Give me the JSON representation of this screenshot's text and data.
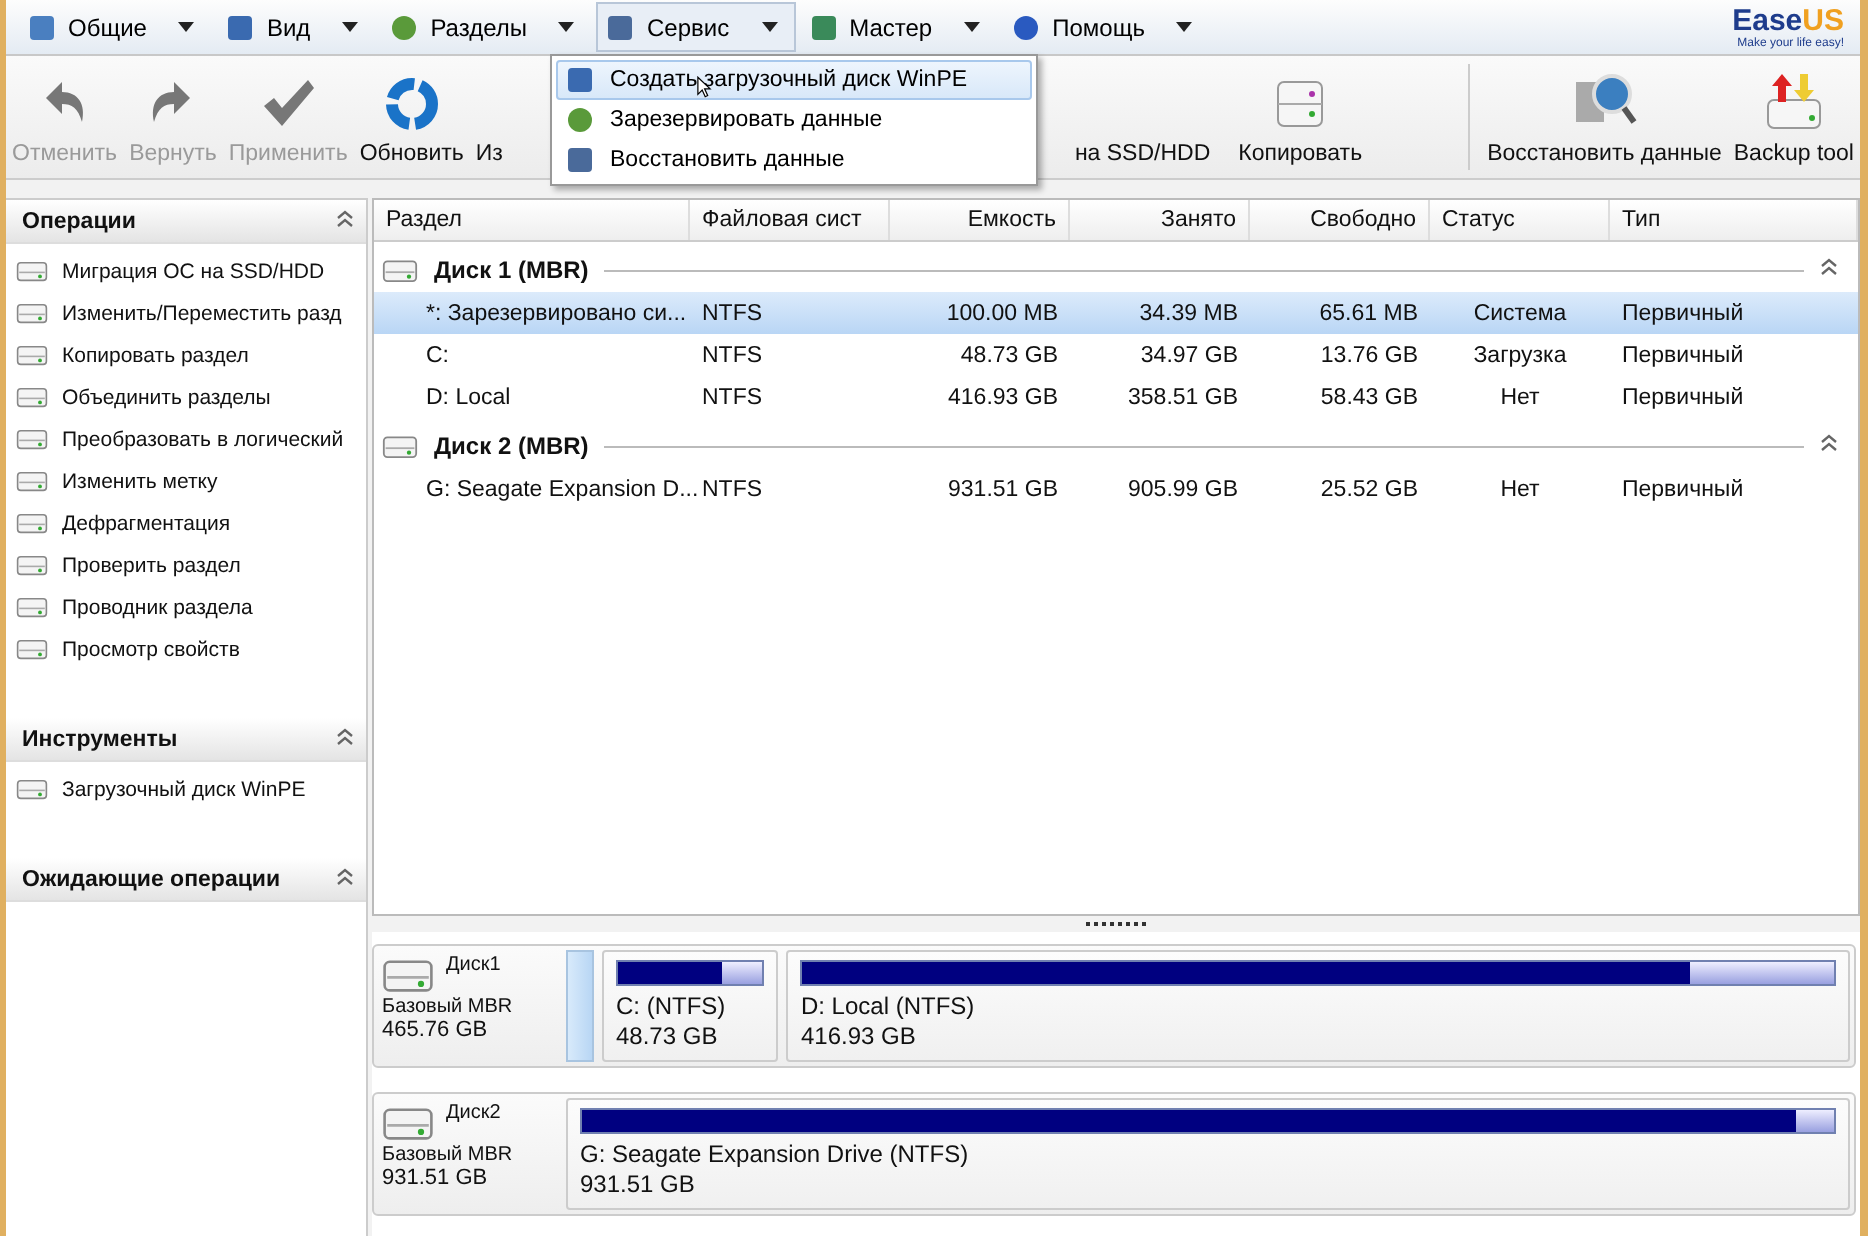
{
  "menu": [
    {
      "label": "Общие",
      "selected": false
    },
    {
      "label": "Вид",
      "selected": false
    },
    {
      "label": "Разделы",
      "selected": false
    },
    {
      "label": "Сервис",
      "selected": true
    },
    {
      "label": "Мастер",
      "selected": false
    },
    {
      "label": "Помощь",
      "selected": false
    }
  ],
  "logo": {
    "name_a": "Ease",
    "name_b": "US",
    "tagline": "Make your life easy!"
  },
  "toolbar": [
    {
      "label": "Отменить",
      "disabled": true
    },
    {
      "label": "Вернуть",
      "disabled": true
    },
    {
      "label": "Применить",
      "disabled": true
    },
    {
      "label": "Обновить",
      "disabled": false
    },
    {
      "label": "Из",
      "disabled": false
    },
    {
      "label": "на SSD/HDD",
      "disabled": false
    },
    {
      "label": "Копировать",
      "disabled": false
    }
  ],
  "toolbar_right": [
    {
      "label": "Восстановить данные"
    },
    {
      "label": "Backup tool"
    }
  ],
  "dropdown": [
    {
      "label": "Создать загрузочный диск WinPE",
      "selected": true
    },
    {
      "label": "Зарезервировать данные",
      "selected": false
    },
    {
      "label": "Восстановить данные",
      "selected": false
    }
  ],
  "sidebar": [
    {
      "title": "Операции",
      "expanded": true,
      "items": [
        "Миграция ОС на SSD/HDD",
        "Изменить/Переместить разд",
        "Копировать раздел",
        "Объединить разделы",
        "Преобразовать в логический",
        "Изменить метку",
        "Дефрагментация",
        "Проверить раздел",
        "Проводник раздела",
        "Просмотр свойств"
      ]
    },
    {
      "title": "Инструменты",
      "expanded": true,
      "items": [
        "Загрузочный диск WinPE"
      ]
    },
    {
      "title": "Ожидающие операции",
      "expanded": true
    }
  ],
  "table": {
    "columns": [
      "Раздел",
      "Файловая сист",
      "Емкость",
      "Занято",
      "Свободно",
      "Статус",
      "Тип"
    ],
    "groups": [
      {
        "title": "Диск 1 (MBR)",
        "expanded": true,
        "rows": [
          {
            "cells": [
              "*: Зарезервировано си...",
              "NTFS",
              "100.00 MB",
              "34.39 MB",
              "65.61 MB",
              "Система",
              "Первичный"
            ],
            "selected": true
          },
          {
            "cells": [
              "C:",
              "NTFS",
              "48.73 GB",
              "34.97 GB",
              "13.76 GB",
              "Загрузка",
              "Первичный"
            ],
            "selected": false
          },
          {
            "cells": [
              "D: Local",
              "NTFS",
              "416.93 GB",
              "358.51 GB",
              "58.43 GB",
              "Нет",
              "Первичный"
            ],
            "selected": false
          }
        ]
      },
      {
        "title": "Диск 2 (MBR)",
        "expanded": true,
        "rows": [
          {
            "cells": [
              "G: Seagate Expansion D...",
              "NTFS",
              "931.51 GB",
              "905.99 GB",
              "25.52 GB",
              "Нет",
              "Первичный"
            ],
            "selected": false
          }
        ]
      }
    ]
  },
  "disks": [
    {
      "name": "Диск1",
      "type": "Базовый MBR",
      "size": "465.76 GB",
      "partitions": [
        {
          "kind": "reserved",
          "selected": true
        },
        {
          "kind": "partition",
          "label": "C: (NTFS)",
          "size": "48.73 GB",
          "level": 0.72,
          "selected": false
        },
        {
          "kind": "partition",
          "label": "D: Local (NTFS)",
          "size": "416.93 GB",
          "level": 0.86,
          "selected": false
        }
      ]
    },
    {
      "name": "Диск2",
      "type": "Базовый MBR",
      "size": "931.51 GB",
      "partitions": [
        {
          "kind": "partition",
          "label": "G: Seagate Expansion Drive (NTFS)",
          "size": "931.51 GB",
          "level": 0.97,
          "selected": false
        }
      ]
    }
  ]
}
